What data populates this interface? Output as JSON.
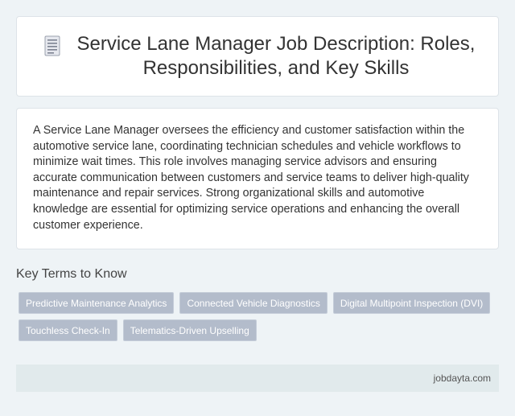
{
  "header": {
    "icon": "document-icon",
    "title": "Service Lane Manager Job Description: Roles, Responsibilities, and Key Skills"
  },
  "description": {
    "text": "A Service Lane Manager oversees the efficiency and customer satisfaction within the automotive service lane, coordinating technician schedules and vehicle workflows to minimize wait times. This role involves managing service advisors and ensuring accurate communication between customers and service teams to deliver high-quality maintenance and repair services. Strong organizational skills and automotive knowledge are essential for optimizing service operations and enhancing the overall customer experience."
  },
  "key_terms": {
    "heading": "Key Terms to Know",
    "tags": [
      "Predictive Maintenance Analytics",
      "Connected Vehicle Diagnostics",
      "Digital Multipoint Inspection (DVI)",
      "Touchless Check-In",
      "Telematics-Driven Upselling"
    ]
  },
  "footer": {
    "site": "jobdayta.com"
  },
  "colors": {
    "background": "#eef3f6",
    "card": "#ffffff",
    "tag_background": "#b3bccb",
    "footer_background": "#e1eaec"
  }
}
